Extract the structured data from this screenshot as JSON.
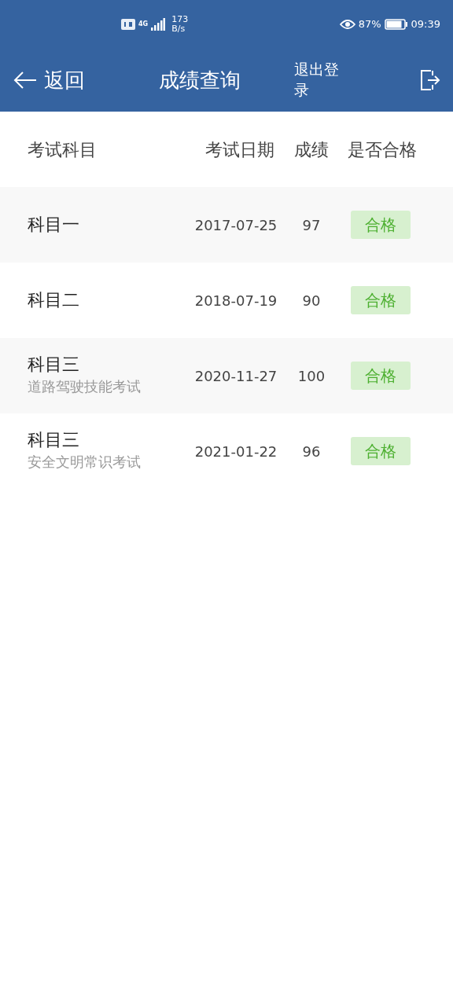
{
  "status_bar": {
    "network": "4G",
    "speed": "173",
    "speed_unit": "B/s",
    "battery": "87%",
    "time": "09:39"
  },
  "nav": {
    "back": "返回",
    "title": "成绩查询",
    "logout": "退出登录"
  },
  "table": {
    "columns": [
      "考试科目",
      "考试日期",
      "成绩",
      "是否合格"
    ],
    "rows": [
      {
        "subject": "科目一",
        "date": "2017-07-25",
        "score": "97",
        "result": "合格",
        "passed": true
      },
      {
        "subject": "科目二",
        "date": "2018-07-19",
        "score": "90",
        "result": "合格",
        "passed": true
      },
      {
        "subject": "科目三",
        "note": "道路驾驶技能考试",
        "date": "2020-11-27",
        "score": "100",
        "result": "合格",
        "passed": true
      },
      {
        "subject": "科目三",
        "note": "安全文明常识考试",
        "date": "2021-01-22",
        "score": "96",
        "result": "合格",
        "passed": true
      }
    ]
  }
}
